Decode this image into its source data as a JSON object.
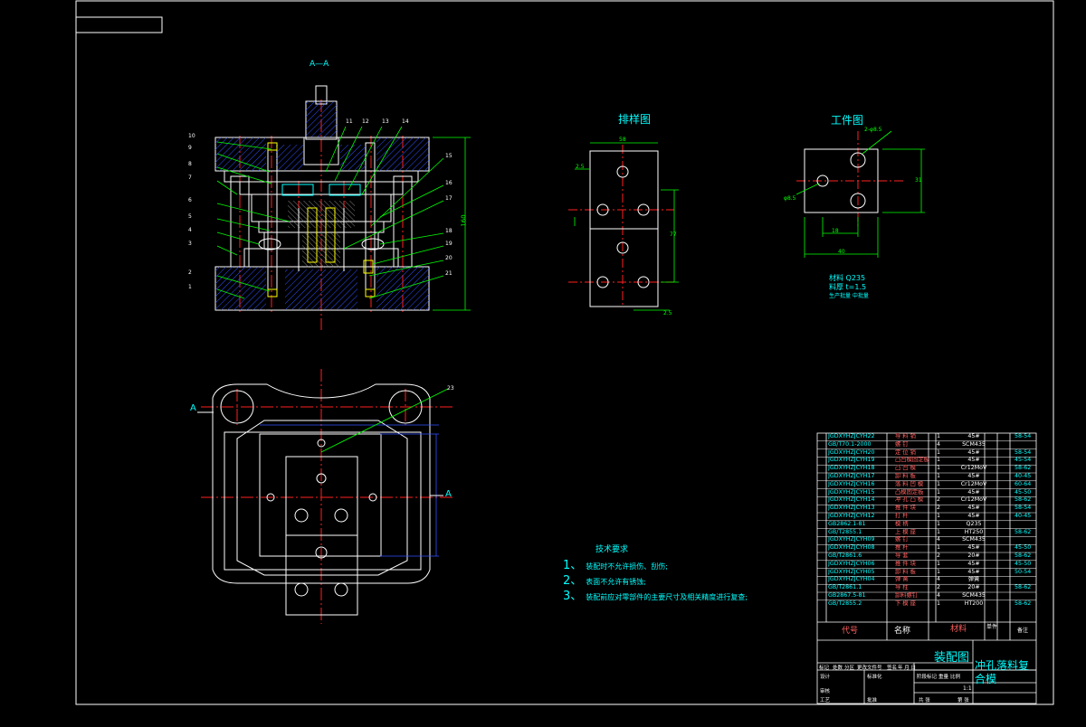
{
  "section_label": "A—A",
  "layout_title": "排样图",
  "workpiece_title": "工件图",
  "workpiece_notes": [
    "材料 Q235",
    "料厚 t=1.5",
    "生产批量 中批量"
  ],
  "workpiece_dims": {
    "hole_callout": "2-φ8.5",
    "hole_single": "φ8.5",
    "width": "40",
    "spacing": "18",
    "height": "31"
  },
  "layout_dims": {
    "width": "58",
    "pitch": "77",
    "margin_left": "2.5",
    "margin_bottom": "2.5"
  },
  "view_marks": {
    "left": "A",
    "right": "A"
  },
  "callouts_left": [
    "10",
    "9",
    "8",
    "7",
    "6",
    "5",
    "4",
    "3",
    "2",
    "1"
  ],
  "callouts_top": [
    "11",
    "12",
    "13",
    "14"
  ],
  "callouts_right": [
    "15",
    "16",
    "17",
    "18",
    "19",
    "20",
    "21"
  ],
  "plan_callout": "23",
  "overall_height": "160",
  "tech_requirements": {
    "title": "技术要求",
    "items": [
      {
        "num": "1、",
        "text": "装配时不允许损伤、刮伤;"
      },
      {
        "num": "2、",
        "text": "表面不允许有锈蚀;"
      },
      {
        "num": "3、",
        "text": "装配前应对零部件的主要尺寸及相关精度进行复查;"
      }
    ]
  },
  "bom": [
    {
      "code": "JGDXYHZJCYH22",
      "name": "导 料 销",
      "qty": "1",
      "material": "45#",
      "hard": "58-54"
    },
    {
      "code": "GB/T70.1-2000",
      "name": "螺 钉",
      "qty": "4",
      "material": "SCM435",
      "hard": ""
    },
    {
      "code": "JGDXYHZJCYH20",
      "name": "定 位 销",
      "qty": "1",
      "material": "45#",
      "hard": "58-54"
    },
    {
      "code": "JGDXYHZJCYH19",
      "name": "凸凹模固定板",
      "qty": "1",
      "material": "45#",
      "hard": "45-54"
    },
    {
      "code": "JGDXYHZJCYH18",
      "name": "凸 凹 模",
      "qty": "1",
      "material": "Cr12MoV",
      "hard": "58-62"
    },
    {
      "code": "JGDXYHZJCYH17",
      "name": "卸 料 板",
      "qty": "1",
      "material": "45#",
      "hard": "40-45"
    },
    {
      "code": "JGDXYHZJCYH16",
      "name": "落 料 凹 模",
      "qty": "1",
      "material": "Cr12MoV",
      "hard": "60-64"
    },
    {
      "code": "JGDXYHZJCYH15",
      "name": "凸模固定板",
      "qty": "1",
      "material": "45#",
      "hard": "45-50"
    },
    {
      "code": "JGDXYHZJCYH14",
      "name": "冲 孔 凸 模",
      "qty": "2",
      "material": "Cr12MoV",
      "hard": "58-62"
    },
    {
      "code": "JGDXYHZJCYH13",
      "name": "推 件 块",
      "qty": "2",
      "material": "45#",
      "hard": "58-54"
    },
    {
      "code": "JGDXYHZJCYH12",
      "name": "打 杆",
      "qty": "1",
      "material": "45#",
      "hard": "40-45"
    },
    {
      "code": "GB2862.1-81",
      "name": "模 柄",
      "qty": "1",
      "material": "Q235",
      "hard": ""
    },
    {
      "code": "GB/T2855.1",
      "name": "上 模 座",
      "qty": "1",
      "material": "HT250",
      "hard": "58-62"
    },
    {
      "code": "JGDXYHZJCYH09",
      "name": "螺 钉",
      "qty": "4",
      "material": "SCM435",
      "hard": ""
    },
    {
      "code": "JGDXYHZJCYH08",
      "name": "推 杆",
      "qty": "1",
      "material": "45#",
      "hard": "45-50"
    },
    {
      "code": "GB/T2861.6",
      "name": "导 套",
      "qty": "2",
      "material": "20#",
      "hard": "58-62"
    },
    {
      "code": "JGDXYHZJCYH06",
      "name": "推 件 块",
      "qty": "1",
      "material": "45#",
      "hard": "45-50"
    },
    {
      "code": "JGDXYHZJCYH05",
      "name": "卸 料 板",
      "qty": "1",
      "material": "45#",
      "hard": "50-54"
    },
    {
      "code": "JGDXYHZJCYH04",
      "name": "弹 簧",
      "qty": "4",
      "material": "弹簧",
      "hard": ""
    },
    {
      "code": "GB/T2861.1",
      "name": "导 柱",
      "qty": "2",
      "material": "20#",
      "hard": "58-62"
    },
    {
      "code": "GB2867.5-81",
      "name": "卸料螺钉",
      "qty": "4",
      "material": "SCM435",
      "hard": ""
    },
    {
      "code": "GB/T2855.2",
      "name": "下 模 座",
      "qty": "1",
      "material": "HT200",
      "hard": "58-62"
    }
  ],
  "bom_header": {
    "code": "代号",
    "name": "名称",
    "material": "材料",
    "weight": "单件",
    "note": "备注"
  },
  "title_block": {
    "drawing_name": "装配图",
    "part_name_line1": "冲孔落料复",
    "part_name_line2": "合模",
    "scale": "1:1",
    "labels": [
      "标记",
      "处数",
      "分区",
      "更改文件号",
      "签名",
      "年 月 日",
      "设计",
      "标准化",
      "阶段标记",
      "重量",
      "比例",
      "审核",
      "工艺",
      "批准",
      "共 张",
      "第 张"
    ]
  }
}
